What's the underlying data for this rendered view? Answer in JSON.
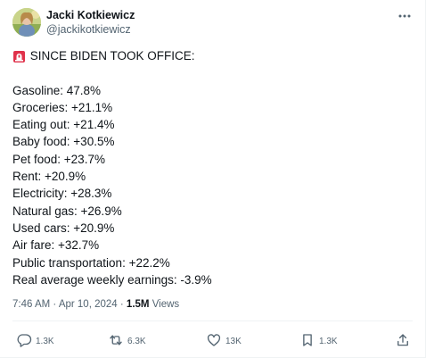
{
  "author": {
    "name": "Jacki Kotkiewicz",
    "handle": "@jackikotkiewicz"
  },
  "headline": "SINCE BIDEN TOOK OFFICE:",
  "stats": [
    "Gasoline: 47.8%",
    "Groceries: +21.1%",
    "Eating out: +21.4%",
    "Baby food: +30.5%",
    "Pet food: +23.7%",
    "Rent: +20.9%",
    "Electricity: +28.3%",
    "Natural gas: +26.9%",
    "Used cars: +20.9%",
    "Air fare: +32.7%",
    "Public transportation: +22.2%",
    "Real average weekly earnings: -3.9%"
  ],
  "meta": {
    "time": "7:46 AM",
    "separator": "·",
    "date": "Apr 10, 2024",
    "views_count": "1.5M",
    "views_label": "Views"
  },
  "actions": {
    "replies": "1.3K",
    "reposts": "6.3K",
    "likes": "13K",
    "bookmarks": "1.3K"
  },
  "icons": {
    "siren": "police-siren-emoji",
    "more": "more-horizontal-icon",
    "reply": "reply-icon",
    "repost": "repost-icon",
    "like": "like-icon",
    "bookmark": "bookmark-icon",
    "share": "share-icon"
  },
  "colors": {
    "text": "#0f1419",
    "secondary": "#536471",
    "divider": "#eff3f4",
    "siren_red": "#e0324b"
  }
}
